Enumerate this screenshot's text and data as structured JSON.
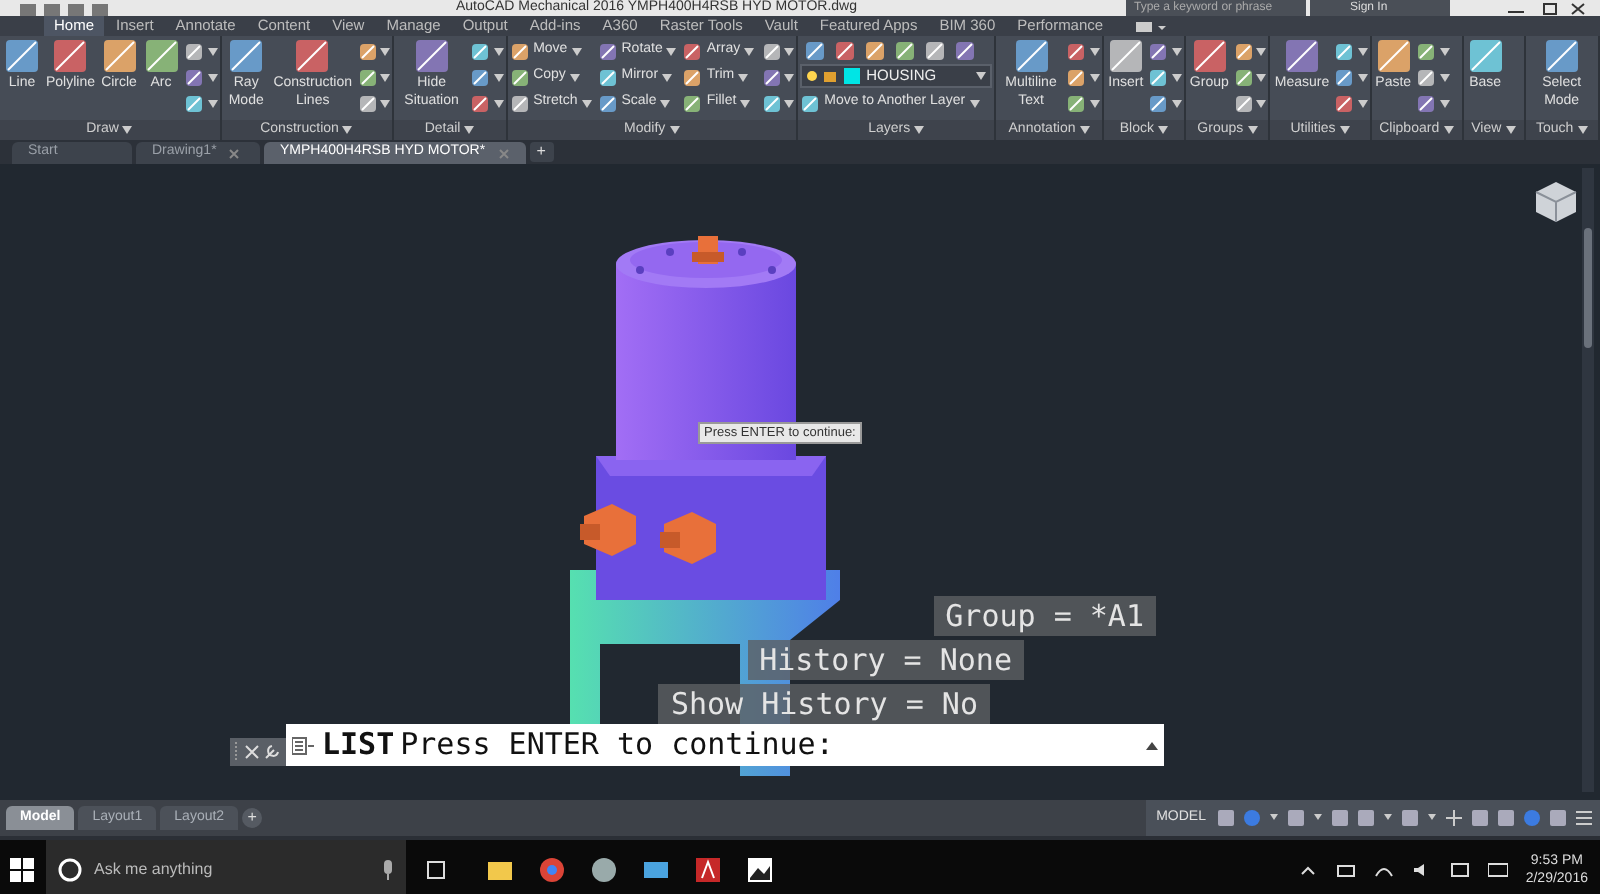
{
  "title_bar": {
    "title": "AutoCAD Mechanical 2016    YMPH400H4RSB HYD MOTOR.dwg",
    "search": {
      "placeholder": "Type a keyword or phrase"
    },
    "sign_in": "Sign In"
  },
  "ribbon_tabs": [
    {
      "label": "Home",
      "selected": true
    },
    {
      "label": "Insert",
      "selected": false
    },
    {
      "label": "Annotate",
      "selected": false
    },
    {
      "label": "Content",
      "selected": false
    },
    {
      "label": "View",
      "selected": false
    },
    {
      "label": "Manage",
      "selected": false
    },
    {
      "label": "Output",
      "selected": false
    },
    {
      "label": "Add-ins",
      "selected": false
    },
    {
      "label": "A360",
      "selected": false
    },
    {
      "label": "Raster Tools",
      "selected": false
    },
    {
      "label": "Vault",
      "selected": false
    },
    {
      "label": "Featured Apps",
      "selected": false
    },
    {
      "label": "BIM 360",
      "selected": false
    },
    {
      "label": "Performance",
      "selected": false
    }
  ],
  "panels": [
    {
      "title": "Draw",
      "columns": [
        [
          {
            "kind": "large",
            "label": "Line"
          }
        ],
        [
          {
            "kind": "large",
            "label": "Polyline"
          }
        ],
        [
          {
            "kind": "large",
            "label": "Circle"
          }
        ],
        [
          {
            "kind": "large",
            "label": "Arc"
          }
        ],
        [
          {
            "kind": "icon"
          },
          {
            "kind": "icon"
          },
          {
            "kind": "icon"
          }
        ]
      ]
    },
    {
      "title": "Construction",
      "columns": [
        [
          {
            "kind": "large",
            "label": "Ray Mode"
          }
        ],
        [
          {
            "kind": "large",
            "label": "Construction Lines"
          }
        ],
        [
          {
            "kind": "icon"
          },
          {
            "kind": "icon"
          },
          {
            "kind": "icon"
          }
        ]
      ]
    },
    {
      "title": "Detail",
      "columns": [
        [
          {
            "kind": "large",
            "label": "Hide Situation"
          }
        ],
        [
          {
            "kind": "icon"
          },
          {
            "kind": "icon"
          },
          {
            "kind": "icon"
          }
        ]
      ]
    },
    {
      "title": "Modify",
      "columns": [
        [
          {
            "kind": "small",
            "label": "Move"
          },
          {
            "kind": "small",
            "label": "Copy"
          },
          {
            "kind": "small",
            "label": "Stretch"
          }
        ],
        [
          {
            "kind": "small",
            "label": "Rotate"
          },
          {
            "kind": "small",
            "label": "Mirror"
          },
          {
            "kind": "small",
            "label": "Scale"
          }
        ],
        [
          {
            "kind": "small",
            "label": "Array"
          },
          {
            "kind": "small",
            "label": "Trim"
          },
          {
            "kind": "small",
            "label": "Fillet"
          }
        ],
        [
          {
            "kind": "icon"
          },
          {
            "kind": "icon"
          },
          {
            "kind": "icon"
          }
        ]
      ]
    },
    {
      "title": "Layers",
      "columns": [
        [
          {
            "kind": "icon_strip"
          },
          {
            "kind": "dropdown",
            "label": "HOUSING"
          },
          {
            "kind": "small",
            "label": "Move to Another Layer"
          }
        ]
      ]
    },
    {
      "title": "Annotation",
      "columns": [
        [
          {
            "kind": "large",
            "label": "Multiline Text"
          }
        ],
        [
          {
            "kind": "icon"
          },
          {
            "kind": "icon"
          },
          {
            "kind": "icon"
          }
        ]
      ]
    },
    {
      "title": "Block",
      "columns": [
        [
          {
            "kind": "large",
            "label": "Insert"
          }
        ],
        [
          {
            "kind": "icon"
          },
          {
            "kind": "icon"
          },
          {
            "kind": "icon"
          }
        ]
      ]
    },
    {
      "title": "Groups",
      "columns": [
        [
          {
            "kind": "large",
            "label": "Group"
          }
        ],
        [
          {
            "kind": "icon"
          },
          {
            "kind": "icon"
          },
          {
            "kind": "icon"
          }
        ]
      ]
    },
    {
      "title": "Utilities",
      "columns": [
        [
          {
            "kind": "large",
            "label": "Measure"
          }
        ],
        [
          {
            "kind": "icon"
          },
          {
            "kind": "icon"
          },
          {
            "kind": "icon"
          }
        ]
      ]
    },
    {
      "title": "Clipboard",
      "columns": [
        [
          {
            "kind": "large",
            "label": "Paste"
          }
        ],
        [
          {
            "kind": "icon"
          },
          {
            "kind": "icon"
          },
          {
            "kind": "icon"
          }
        ]
      ]
    },
    {
      "title": "View",
      "columns": [
        [
          {
            "kind": "large",
            "label": "Base"
          }
        ]
      ]
    },
    {
      "title": "Touch",
      "columns": [
        [
          {
            "kind": "large",
            "label": "Select Mode"
          }
        ]
      ]
    }
  ],
  "doc_tabs": [
    {
      "label": "Start",
      "selected": false,
      "closable": false
    },
    {
      "label": "Drawing1*",
      "selected": false,
      "closable": true
    },
    {
      "label": "YMPH400H4RSB HYD MOTOR*",
      "selected": true,
      "closable": true
    }
  ],
  "new_tab": "+",
  "viewport": {
    "tooltip": "Press ENTER to continue:",
    "history_lines": [
      "Group = *A1",
      "History = None",
      "Show History = No"
    ],
    "command_line": {
      "command": "LIST",
      "prompt": "Press ENTER to continue:"
    }
  },
  "layout_tabs": [
    {
      "label": "Model",
      "selected": true
    },
    {
      "label": "Layout1",
      "selected": false
    },
    {
      "label": "Layout2",
      "selected": false
    }
  ],
  "new_layout": "+",
  "status_bar": {
    "space": "MODEL"
  },
  "taskbar": {
    "search": {
      "placeholder": "Ask me anything"
    },
    "time": "9:53 PM",
    "date": "2/29/2016"
  }
}
